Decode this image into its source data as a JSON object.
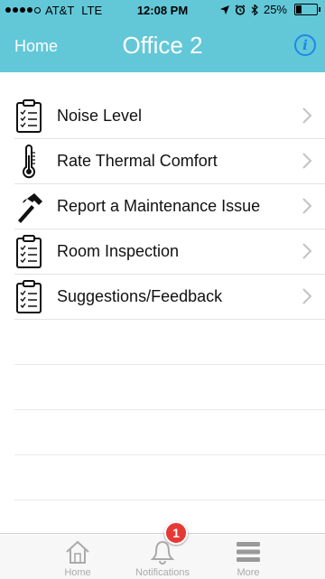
{
  "status_bar": {
    "carrier": "AT&T",
    "network": "LTE",
    "time": "12:08 PM",
    "battery": "25%",
    "signal_bars": 4
  },
  "nav": {
    "back_label": "Home",
    "title": "Office 2",
    "info_icon": "info-icon"
  },
  "menu": {
    "items": [
      {
        "label": "Noise Level",
        "icon": "clipboard-icon"
      },
      {
        "label": "Rate Thermal Comfort",
        "icon": "thermometer-icon"
      },
      {
        "label": "Report a Maintenance Issue",
        "icon": "hammer-icon"
      },
      {
        "label": "Room Inspection",
        "icon": "clipboard-icon"
      },
      {
        "label": "Suggestions/Feedback",
        "icon": "clipboard-icon"
      }
    ]
  },
  "tabs": [
    {
      "label": "Home",
      "icon": "house-icon"
    },
    {
      "label": "Notifications",
      "icon": "bell-icon",
      "badge": "1"
    },
    {
      "label": "More",
      "icon": "menu-icon"
    }
  ],
  "colors": {
    "header": "#62c8d8",
    "info": "#1e88e5",
    "badge": "#e53935"
  }
}
